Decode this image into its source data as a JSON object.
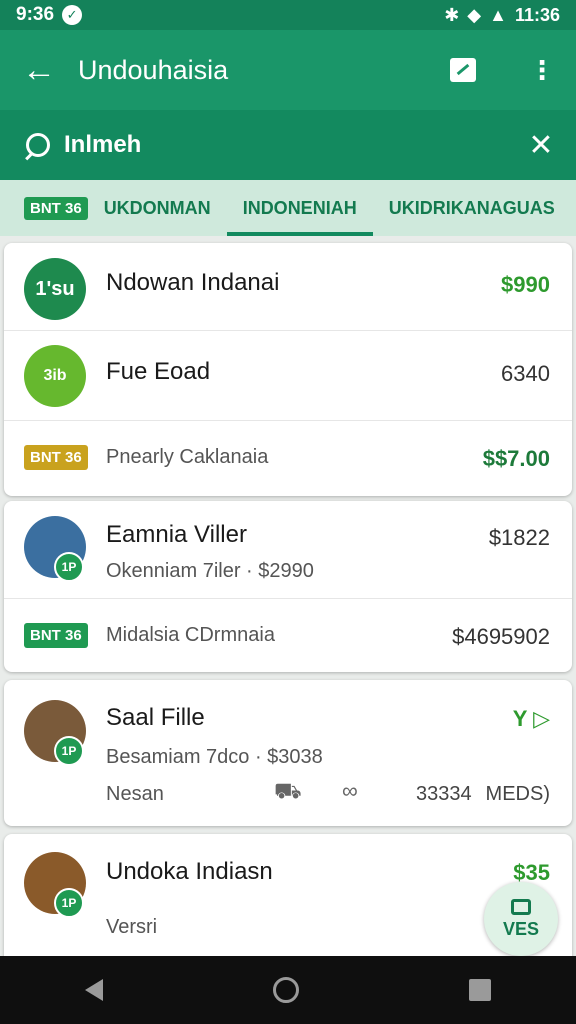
{
  "status": {
    "time": "9:36",
    "clock": "11:36"
  },
  "appbar": {
    "title": "Undouhaisia"
  },
  "search": {
    "query": "Inlmeh"
  },
  "tabs": {
    "badge": "BNT 36",
    "items": [
      "UKDONMAN",
      "INDONENIAH",
      "UKIDRIKANAGUAS"
    ],
    "active_index": 1
  },
  "cards": [
    {
      "rows": [
        {
          "avatar_text": "1'su",
          "name": "Ndowan Indanai",
          "amount": "$990"
        },
        {
          "avatar_text": "3ib",
          "name": "Fue Eoad",
          "amount": "6340"
        },
        {
          "badge": "BNT 36",
          "name": "Pnearly Caklanaia",
          "amount": "$$7.00"
        }
      ]
    },
    {
      "rows": [
        {
          "avatar_mini": "1P",
          "name": "Eamnia Viller",
          "sub": "Okenniam 7iler · $2990",
          "amount": "$1822"
        },
        {
          "badge": "BNT 36",
          "name": "Midalsia CDrmnaia",
          "amount": "$4695902"
        }
      ]
    },
    {
      "rows": [
        {
          "avatar_mini": "1P",
          "name": "Saal Fille",
          "sub": "Besamiam 7dco · $3038",
          "amount": "Y ▷"
        },
        {
          "name": "Nesan",
          "extra1": "33334",
          "extra2": "MEDS)"
        }
      ]
    },
    {
      "rows": [
        {
          "avatar_mini": "1P",
          "name": "Undoka Indiasn",
          "sub": "Versri",
          "amount": "$35"
        }
      ]
    }
  ],
  "fab": {
    "label": "VES"
  },
  "colors": {
    "primary": "#1a9669",
    "primary_dark": "#14825a",
    "accent": "#2e9a2e"
  }
}
